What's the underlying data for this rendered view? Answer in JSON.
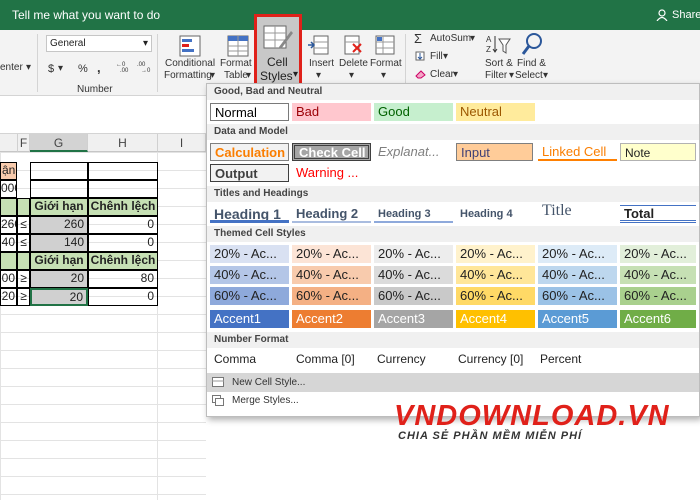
{
  "topbar": {
    "tell_me": "Tell me what you want to do",
    "share": "Share",
    "accent": "#217346"
  },
  "ribbon": {
    "align_fragment": "enter",
    "number_group": "Number",
    "number_format": "General",
    "currency": "$",
    "percent": "%",
    "comma": ",",
    "conditional_formatting_1": "Conditional",
    "conditional_formatting_2": "Formatting",
    "format_as_table_1": "Format as",
    "format_as_table_2": "Table",
    "cell_styles_1": "Cell",
    "cell_styles_2": "Styles",
    "insert": "Insert",
    "delete": "Delete",
    "format": "Format",
    "autosum": "AutoSum",
    "fill": "Fill",
    "clear": "Clear",
    "sort_filter_1": "Sort &",
    "sort_filter_2": "Filter",
    "find_select_1": "Find &",
    "find_select_2": "Select"
  },
  "sheet": {
    "columns": [
      "F",
      "G",
      "H",
      "I"
    ],
    "rows": [
      {
        "a": "ận",
        "f": "",
        "g": "",
        "h": ""
      },
      {
        "a": "000",
        "f": "",
        "g": "",
        "h": ""
      },
      {
        "a": "",
        "f": "",
        "g": "Giới hạn",
        "h": "Chênh lệch"
      },
      {
        "a": "260",
        "f": "≤",
        "g": "260",
        "h": "0"
      },
      {
        "a": "40",
        "f": "≤",
        "g": "140",
        "h": "0"
      },
      {
        "a": "",
        "f": "",
        "g": "Giới hạn",
        "h": "Chênh lệch"
      },
      {
        "a": "00",
        "f": "≥",
        "g": "20",
        "h": "80"
      },
      {
        "a": "20",
        "f": "≥",
        "g": "20",
        "h": "0"
      }
    ]
  },
  "gallery": {
    "sections": {
      "good_bad": "Good, Bad and Neutral",
      "data_model": "Data and Model",
      "titles": "Titles and Headings",
      "themed": "Themed Cell Styles",
      "number_format": "Number Format"
    },
    "good_bad": [
      "Normal",
      "Bad",
      "Good",
      "Neutral"
    ],
    "data_model_row1": [
      "Calculation",
      "Check Cell",
      "Explanat...",
      "Input",
      "Linked Cell",
      "Note"
    ],
    "data_model_row2": [
      "Output",
      "Warning ..."
    ],
    "titles": [
      "Heading 1",
      "Heading 2",
      "Heading 3",
      "Heading 4",
      "Title",
      "Total"
    ],
    "themed_20": [
      "20% - Ac...",
      "20% - Ac...",
      "20% - Ac...",
      "20% - Ac...",
      "20% - Ac...",
      "20% - Ac..."
    ],
    "themed_40": [
      "40% - Ac...",
      "40% - Ac...",
      "40% - Ac...",
      "40% - Ac...",
      "40% - Ac...",
      "40% - Ac..."
    ],
    "themed_60": [
      "60% - Ac...",
      "60% - Ac...",
      "60% - Ac...",
      "60% - Ac...",
      "60% - Ac...",
      "60% - Ac..."
    ],
    "accents": [
      "Accent1",
      "Accent2",
      "Accent3",
      "Accent4",
      "Accent5",
      "Accent6"
    ],
    "number_formats": [
      "Comma",
      "Comma [0]",
      "Currency",
      "Currency [0]",
      "Percent"
    ],
    "new_style": "New Cell Style...",
    "merge_styles": "Merge Styles..."
  },
  "watermark": {
    "brand": "VNDOWNLOAD.VN",
    "tagline": "CHIA SẺ PHẦN MỀM MIỄN PHÍ"
  },
  "colors": {
    "highlight": "#e0211a",
    "accent1": "#4472c4",
    "accent2": "#ed7d31",
    "accent3": "#a5a5a5",
    "accent4": "#ffc000",
    "accent5": "#5b9bd5",
    "accent6": "#70ad47"
  }
}
